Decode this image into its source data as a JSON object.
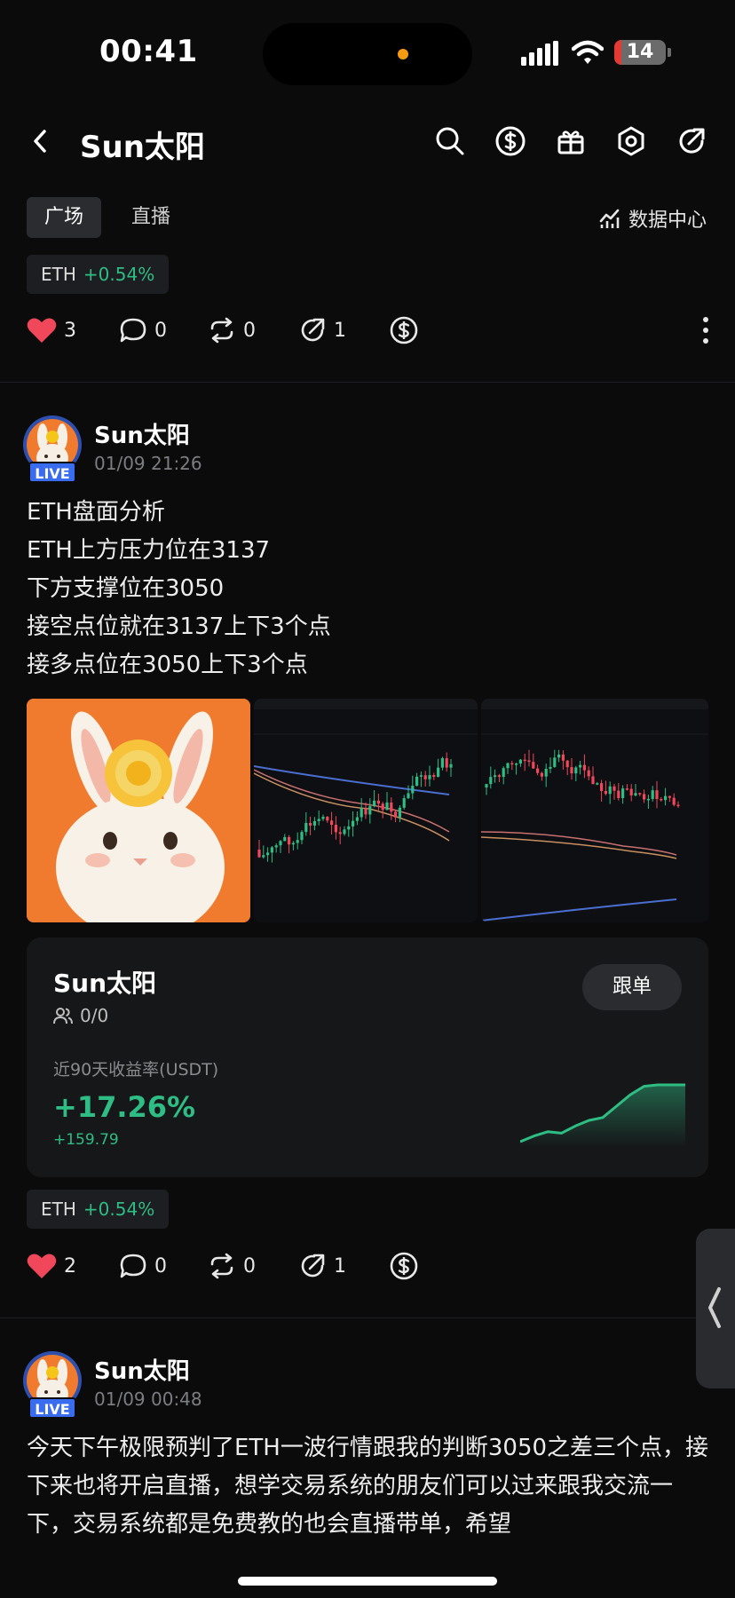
{
  "status_bar": {
    "time": "00:41",
    "battery": "14",
    "battery_level": 0.14
  },
  "header": {
    "title": "Sun太阳"
  },
  "tabs": [
    {
      "label": "广场",
      "active": true
    },
    {
      "label": "直播",
      "active": false
    }
  ],
  "data_center": {
    "label": "数据中心"
  },
  "posts": [
    {
      "chip": {
        "symbol": "ETH",
        "change": "+0.54%"
      },
      "actions": {
        "likes": "3",
        "comments": "0",
        "reposts": "0",
        "shares": "1"
      }
    },
    {
      "author": "Sun太阳",
      "live_label": "LIVE",
      "time": "01/09 21:26",
      "lines": [
        "ETH盘面分析",
        "ETH上方压力位在3137",
        "下方支撑位在3050",
        "接空点位就在3137上下3个点",
        "接多点位在3050上下3个点"
      ],
      "copy_card": {
        "name": "Sun太阳",
        "followers": "0/0",
        "follow_label": "跟单",
        "yield_label": "近90天收益率(USDT)",
        "yield_pct": "+17.26%",
        "yield_abs": "+159.79",
        "sparkline": [
          0,
          8,
          14,
          12,
          22,
          30,
          34,
          50,
          66,
          78,
          80,
          80,
          80
        ]
      },
      "chip": {
        "symbol": "ETH",
        "change": "+0.54%"
      },
      "actions": {
        "likes": "2",
        "comments": "0",
        "reposts": "0",
        "shares": "1"
      }
    },
    {
      "author": "Sun太阳",
      "live_label": "LIVE",
      "time": "01/09 00:48",
      "text": "今天下午极限预判了ETH一波行情跟我的判断3050之差三个点，接下来也将开启直播，想学交易系统的朋友们可以过来跟我交流一下，交易系统都是免费教的也会直播带单，希望"
    }
  ],
  "colors": {
    "background": "#0b0b0c",
    "positive": "#2ebd85",
    "like": "#f0475a",
    "live": "#3a6cf0"
  },
  "icons": [
    "back-arrow-icon",
    "search-icon",
    "dollar-circle-icon",
    "gift-icon",
    "settings-hexagon-icon",
    "share-icon",
    "data-chart-icon",
    "heart-icon",
    "comment-icon",
    "repost-icon",
    "share-icon",
    "tip-dollar-icon",
    "more-vertical-icon",
    "user-group-icon",
    "chevron-left-icon"
  ]
}
